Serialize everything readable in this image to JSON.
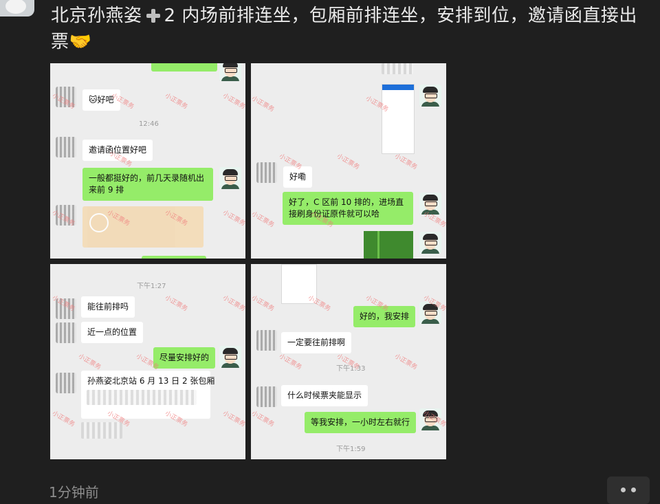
{
  "post": {
    "text_before": "北京孙燕姿",
    "text_after": "2 内场前排连坐，包厢前排连坐，安排到位，邀请函直接出票",
    "emoji": "🤝",
    "time": "1分钟前"
  },
  "watermark": "小正票务",
  "screens": [
    {
      "messages": [
        {
          "text": "🐱好吧"
        },
        {
          "time": "12:46"
        },
        {
          "text": "邀请函位置好吧"
        },
        {
          "text": "一般都挺好的，前几天录随机出来前 9 排"
        }
      ]
    },
    {
      "messages": [
        {
          "text": "好嘞"
        },
        {
          "text": "好了，C 区前 10 排的，进场直接刷身份证原件就可以哈"
        }
      ]
    },
    {
      "messages": [
        {
          "time": "下午1:27"
        },
        {
          "text": "能往前排吗"
        },
        {
          "text": "近一点的位置"
        },
        {
          "text": "尽量安排好的"
        },
        {
          "text": "孙燕姿北京站 6 月 13 日 2 张包厢"
        }
      ]
    },
    {
      "messages": [
        {
          "text": "好的，我安排"
        },
        {
          "text": "一定要往前排啊"
        },
        {
          "time": "下午1:33"
        },
        {
          "text": "什么时候票夹能显示"
        },
        {
          "text": "等我安排，一小时左右就行"
        },
        {
          "time": "下午1:59"
        }
      ]
    }
  ],
  "colors": {
    "background": "#1f1f1f",
    "chat_bg": "#ededed",
    "green_bubble": "#95ec69",
    "white_bubble": "#ffffff"
  },
  "icons": {
    "more": "more-dots-icon",
    "handshake": "handshake-emoji"
  }
}
